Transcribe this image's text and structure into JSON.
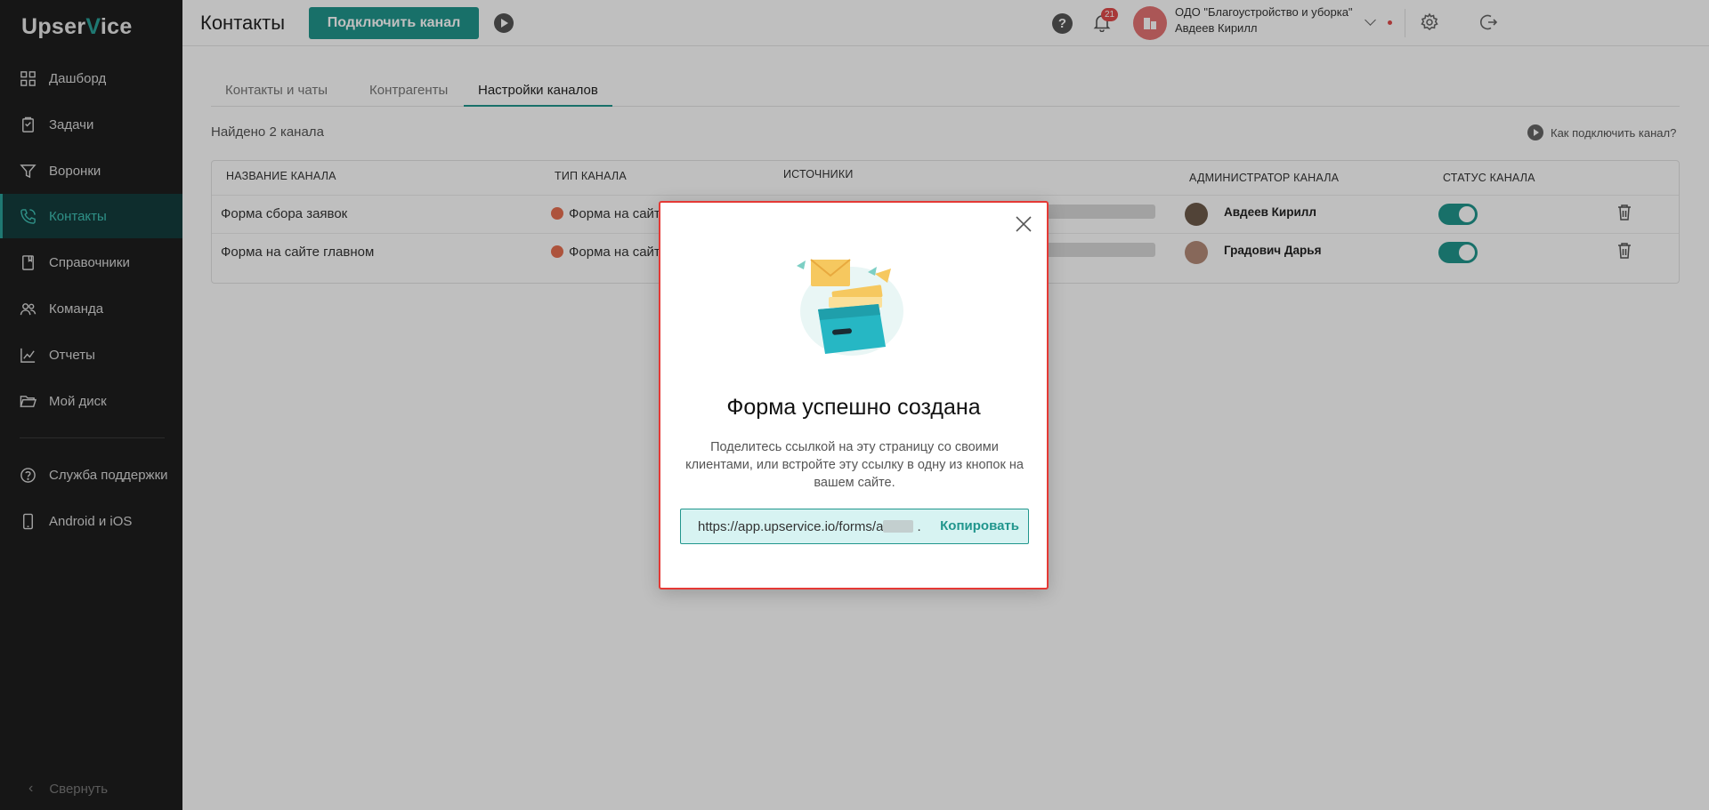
{
  "app": {
    "logo": {
      "part1": "Upser",
      "part2": "V",
      "part3": "ice"
    }
  },
  "sidebar": {
    "items": [
      {
        "label": "Дашборд",
        "icon": "dashboard-icon"
      },
      {
        "label": "Задачи",
        "icon": "tasks-icon"
      },
      {
        "label": "Воронки",
        "icon": "funnel-icon"
      },
      {
        "label": "Контакты",
        "icon": "contacts-phone-icon",
        "active": true
      },
      {
        "label": "Справочники",
        "icon": "book-icon"
      },
      {
        "label": "Команда",
        "icon": "team-icon"
      },
      {
        "label": "Отчеты",
        "icon": "chart-icon"
      },
      {
        "label": "Мой диск",
        "icon": "folder-icon"
      }
    ],
    "bottom_items": [
      {
        "label": "Служба поддержки",
        "icon": "help-circle-icon"
      },
      {
        "label": "Android и iOS",
        "icon": "mobile-icon"
      }
    ],
    "collapse_label": "Свернуть"
  },
  "header": {
    "title": "Контакты",
    "connect_button": "Подключить канал",
    "notifications_count": "21",
    "company": "ОДО \"Благоустройство и уборка\"",
    "user": "Авдеев Кирилл"
  },
  "tabs": [
    {
      "label": "Контакты и чаты"
    },
    {
      "label": "Контрагенты"
    },
    {
      "label": "Настройки каналов",
      "active": true
    }
  ],
  "found_text": "Найдено 2 канала",
  "howto_link": "Как подключить канал?",
  "table": {
    "columns": [
      "Название канала",
      "Тип канала",
      "Источники",
      "Администратор канала",
      "Статус канала"
    ],
    "rows": [
      {
        "name": "Форма сбора заявок",
        "type": "Форма на сайте",
        "admin": "Авдеев Кирилл",
        "status_on": true
      },
      {
        "name": "Форма на сайте главном",
        "type": "Форма на сайте",
        "admin": "Градович Дарья",
        "status_on": true
      }
    ]
  },
  "modal": {
    "title": "Форма успешно создана",
    "description": "Поделитесь ссылкой на эту страницу со своими клиентами, или встройте эту ссылку в одну из кнопок на вашем сайте.",
    "link": "https://app.upservice.io/forms/a",
    "link_suffix": ".",
    "copy_label": "Копировать"
  },
  "colors": {
    "accent": "#21968d",
    "sidebar_bg": "#1e1e1e",
    "active_nav_bg": "#133d3c",
    "modal_border": "#e53935"
  }
}
